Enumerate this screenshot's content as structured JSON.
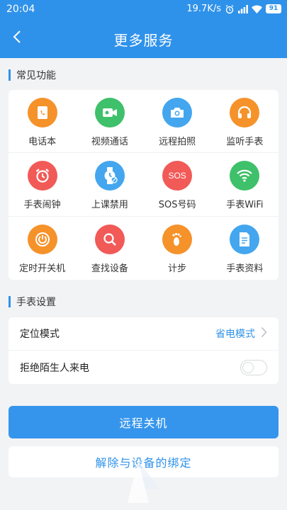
{
  "status_bar": {
    "time": "20:04",
    "network_speed": "19.7K/s",
    "battery": "91"
  },
  "nav": {
    "title": "更多服务"
  },
  "sections": {
    "features_title": "常见功能",
    "settings_title": "手表设置"
  },
  "features": [
    {
      "label": "电话本",
      "icon": "phonebook-icon",
      "color": "#f5922a"
    },
    {
      "label": "视频通话",
      "icon": "video-call-icon",
      "color": "#3fc06a"
    },
    {
      "label": "远程拍照",
      "icon": "camera-icon",
      "color": "#43a6ee"
    },
    {
      "label": "监听手表",
      "icon": "headphones-icon",
      "color": "#f5922a"
    },
    {
      "label": "手表闹钟",
      "icon": "alarm-clock-icon",
      "color": "#f15a57"
    },
    {
      "label": "上课禁用",
      "icon": "watch-disabled-icon",
      "color": "#43a6ee"
    },
    {
      "label": "SOS号码",
      "icon": "sos-icon",
      "color": "#f15a57",
      "icon_text": "SOS"
    },
    {
      "label": "手表WiFi",
      "icon": "wifi-icon",
      "color": "#3fc06a"
    },
    {
      "label": "定时开关机",
      "icon": "power-icon",
      "color": "#f5922a"
    },
    {
      "label": "查找设备",
      "icon": "search-icon",
      "color": "#f15a57"
    },
    {
      "label": "计步",
      "icon": "footprint-icon",
      "color": "#f5922a"
    },
    {
      "label": "手表资料",
      "icon": "document-icon",
      "color": "#43a6ee"
    }
  ],
  "settings": {
    "location_mode_label": "定位模式",
    "location_mode_value": "省电模式",
    "reject_strangers_label": "拒绝陌生人来电"
  },
  "buttons": {
    "remote_shutdown": "远程关机",
    "unbind_device": "解除与设备的绑定"
  },
  "colors": {
    "accent": "#2f92ea",
    "background": "#f2f3f5"
  }
}
